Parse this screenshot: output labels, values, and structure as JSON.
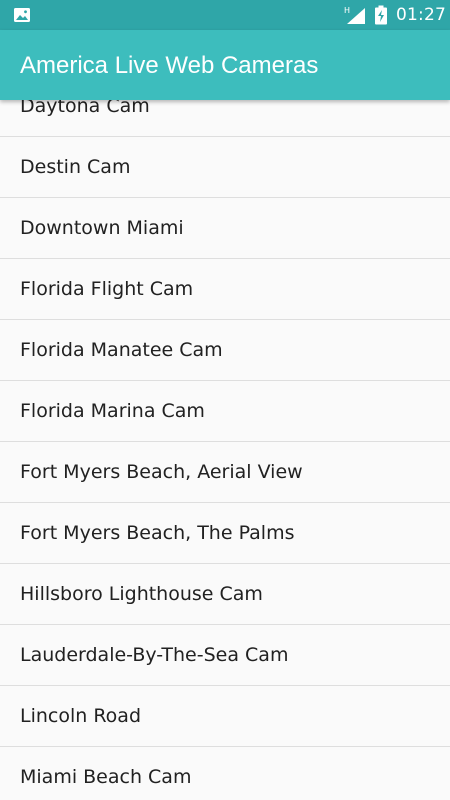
{
  "status_bar": {
    "time": "01:27",
    "network_type": "H",
    "icons": [
      "image-notification-icon",
      "signal-icon",
      "battery-icon"
    ]
  },
  "app_bar": {
    "title": "America Live Web Cameras"
  },
  "list": {
    "items": [
      {
        "label": "Daytona Cam"
      },
      {
        "label": "Destin Cam"
      },
      {
        "label": "Downtown Miami"
      },
      {
        "label": "Florida Flight Cam"
      },
      {
        "label": "Florida Manatee Cam"
      },
      {
        "label": "Florida Marina Cam"
      },
      {
        "label": "Fort Myers Beach, Aerial View"
      },
      {
        "label": "Fort Myers Beach, The Palms"
      },
      {
        "label": "Hillsboro Lighthouse Cam"
      },
      {
        "label": "Lauderdale-By-The-Sea Cam"
      },
      {
        "label": "Lincoln Road"
      },
      {
        "label": "Miami Beach Cam"
      }
    ]
  },
  "colors": {
    "status_bar_bg": "#2fa6a8",
    "app_bar_bg": "#3dbdbd",
    "list_bg": "#fafafa",
    "divider": "#dedede",
    "text_primary": "#212121"
  }
}
